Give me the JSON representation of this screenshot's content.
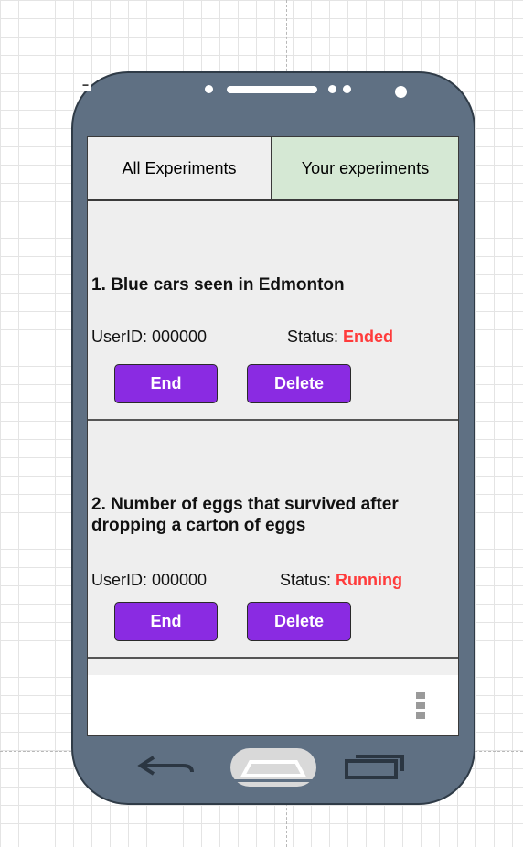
{
  "tabs": {
    "all": "All Experiments",
    "yours": "Your experiments"
  },
  "experiments": [
    {
      "title": "1. Blue cars seen in Edmonton",
      "user_id": "UserID: 000000",
      "status_label": "Status:",
      "status_value": "Ended",
      "end_label": "End",
      "delete_label": "Delete"
    },
    {
      "title": "2. Number of eggs that survived after dropping a carton of eggs",
      "user_id": "UserID: 000000",
      "status_label": "Status:",
      "status_value": "Running",
      "end_label": "End",
      "delete_label": "Delete"
    }
  ],
  "icons": {
    "collapse": "minus-icon",
    "overflow_menu": "vertical-dots-icon",
    "back": "back-arrow-icon",
    "home": "home-icon",
    "recent": "recent-apps-icon"
  },
  "colors": {
    "button": "#8a2be2",
    "status": "#ff3b3b",
    "active_tab": "#d5e8d4",
    "phone_body": "#5f7083"
  }
}
